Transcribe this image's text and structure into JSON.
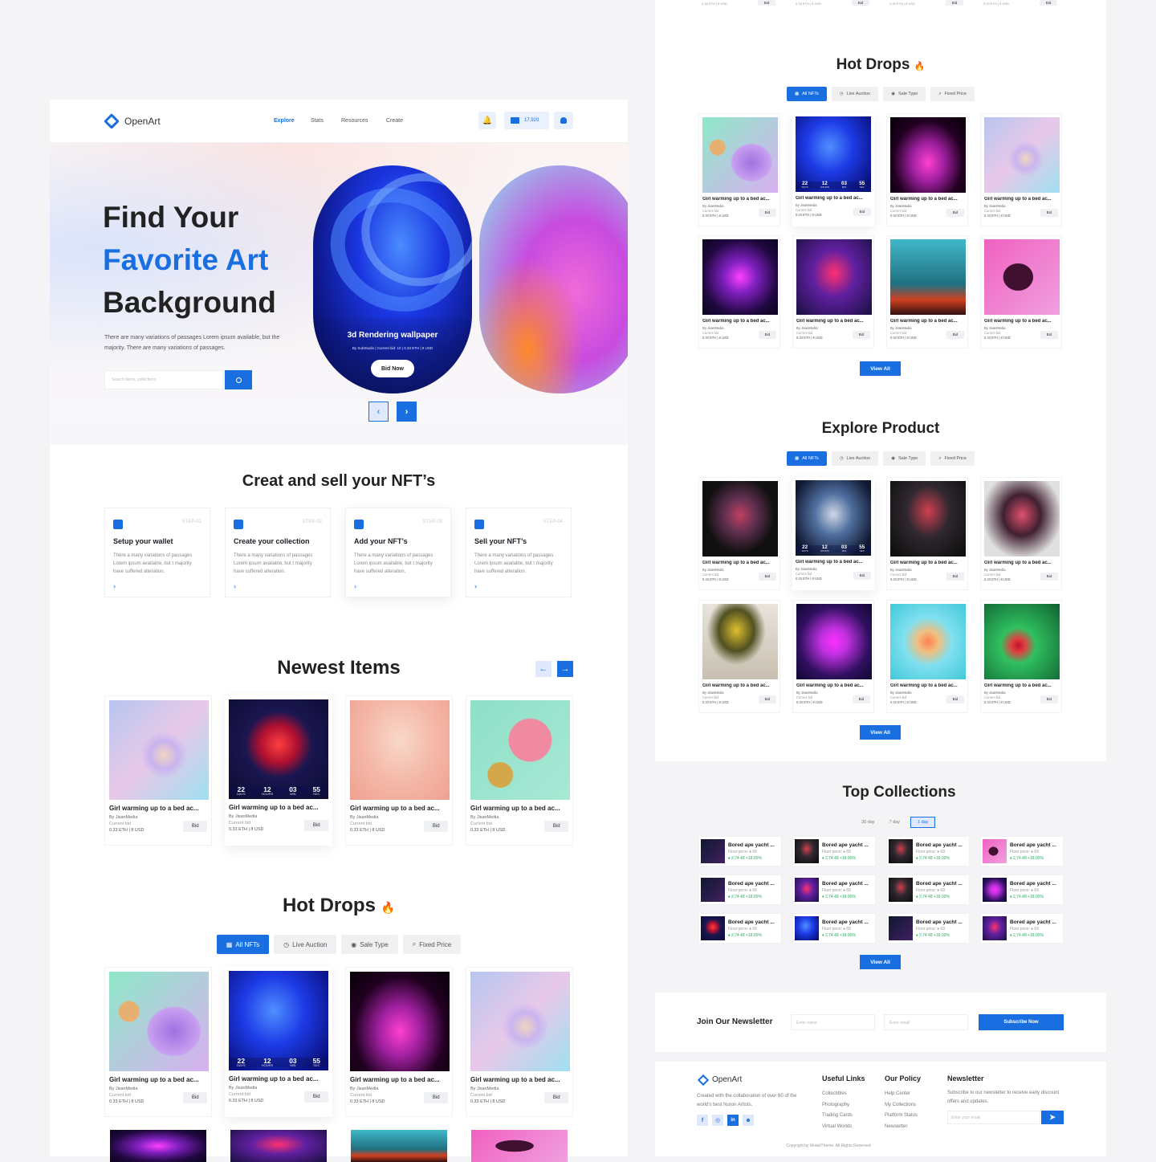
{
  "brand": {
    "name": "OpenArt"
  },
  "nav": {
    "links": [
      "Explore",
      "Stats",
      "Resources",
      "Create"
    ],
    "wallet_value": "17,920"
  },
  "hero": {
    "title_line1": "Find Your",
    "title_line2": "Favorite Art",
    "title_line3": "Background",
    "desc": "There are many variations of passages Lorem ipsum available, but the majority. There are many variations of passages.",
    "search_placeholder": "Search items, collections",
    "feature_title": "3d Rendering wallpaper",
    "feature_meta": "By SubStudio | Current bid: 10 | 0.33 ETH | 8 USD",
    "feature_button": "Bid Now"
  },
  "steps_section": {
    "title": "Creat and sell your NFT’s",
    "steps": [
      {
        "number": "STEP-01",
        "title": "Setup your wallet",
        "desc": "There a many variations of passages Lorem ipsum available, but t majority have suffered alteration."
      },
      {
        "number": "STEP-02",
        "title": "Create your collection",
        "desc": "There a many variations of passages Lorem ipsum available, but t majority have suffered alteration."
      },
      {
        "number": "STEP-03",
        "title": "Add your NFT’s",
        "desc": "There a many variations of passages Lorem ipsum available, but t majority have suffered alteration."
      },
      {
        "number": "STEP-04",
        "title": "Sell your NFT’s",
        "desc": "There a many variations of passages Lorem ipsum available, but t majority have suffered alteration."
      }
    ]
  },
  "card_text": {
    "title": "Girl warming up to a bed ac...",
    "author": "By JisanMedia",
    "bid_label": "Current bid",
    "price": "0.33 ETH | 8 USD",
    "bid_button": "Bid"
  },
  "timer": {
    "days": "22",
    "hours": "12",
    "min": "03",
    "sec": "55",
    "days_label": "DAYS",
    "hours_label": "HOURS",
    "min_label": "MIN",
    "sec_label": "SEC"
  },
  "newest": {
    "title": "Newest Items"
  },
  "hot_drops": {
    "title": "Hot Drops",
    "emoji": "🔥"
  },
  "filter_tabs": [
    "All NFTs",
    "Live Auction",
    "Sale Type",
    "Fixed Price"
  ],
  "explore": {
    "title": "Explore Product"
  },
  "view_all": "View All",
  "top_collections": {
    "title": "Top Collections",
    "periods": [
      "30 day",
      "7 day",
      "1 day"
    ],
    "item_name": "Bored ape yacht ...",
    "item_floor": "Floor price: ♦ 69",
    "item_stat": "♦ 2,74.48  +18.00%"
  },
  "newsletter": {
    "title": "Join Our Newsletter",
    "name_placeholder": "Enter name",
    "email_placeholder": "Enter email",
    "button": "Subscribe Now"
  },
  "footer": {
    "desc": "Created with the collaboration of over 60 of the world's best Nuron Artists.",
    "col1_title": "Useful Links",
    "col1_links": [
      "Collectibles",
      "Photography",
      "Trading Cards",
      "Virtual Worlds"
    ],
    "col2_title": "Our Policy",
    "col2_links": [
      "Help Center",
      "My Collections",
      "Platform Status",
      "Newsletter"
    ],
    "col3_title": "Newsletter",
    "col3_desc": "Subscribe to our newsletter to receive early discount offers and updates.",
    "col3_placeholder": "Enter your email",
    "copyright": "Copyright by ModelTheme. All Rights Reserved"
  },
  "colors": {
    "accent": "#1a6fe0",
    "text": "#1c1c24",
    "muted": "#999999",
    "tab_bg": "#f0f0f3"
  }
}
